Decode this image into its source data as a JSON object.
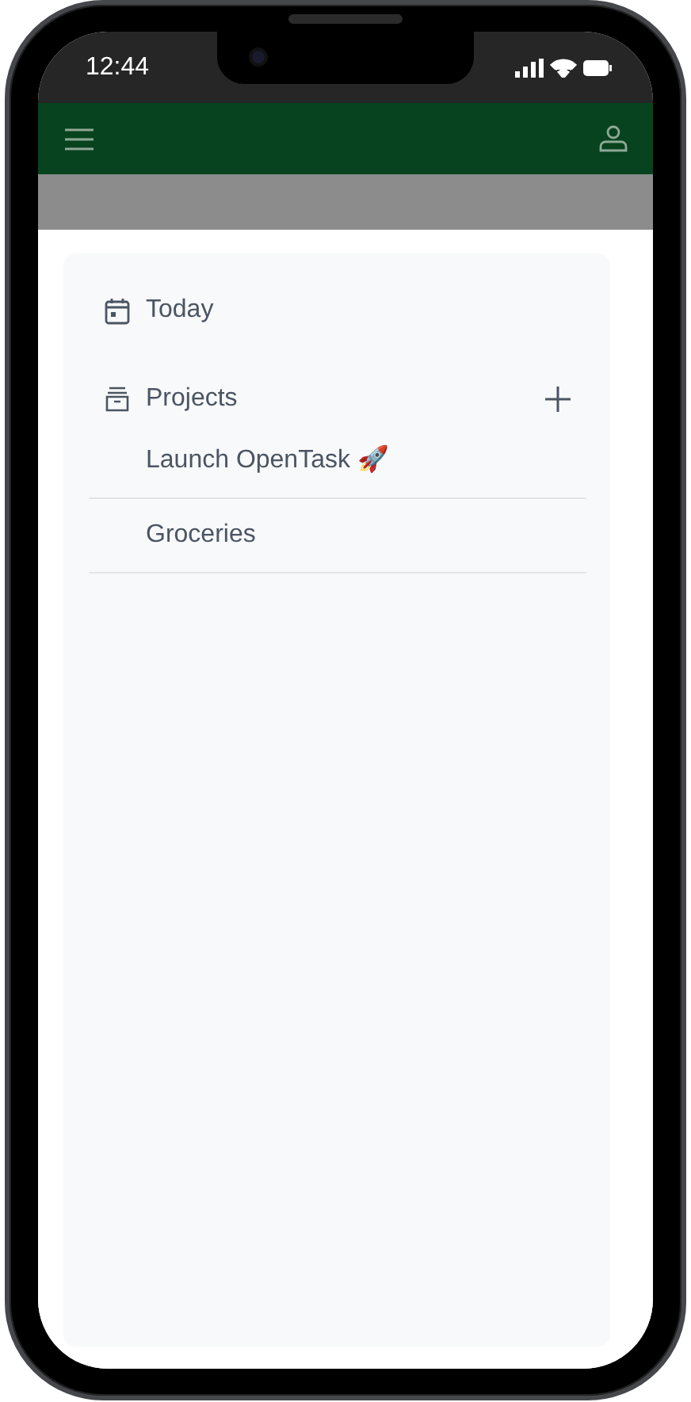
{
  "status_bar": {
    "time": "12:44"
  },
  "sidebar": {
    "today": {
      "label": "Today"
    },
    "projects": {
      "label": "Projects",
      "items": [
        {
          "name": "Launch OpenTask 🚀"
        },
        {
          "name": "Groceries"
        }
      ]
    }
  }
}
